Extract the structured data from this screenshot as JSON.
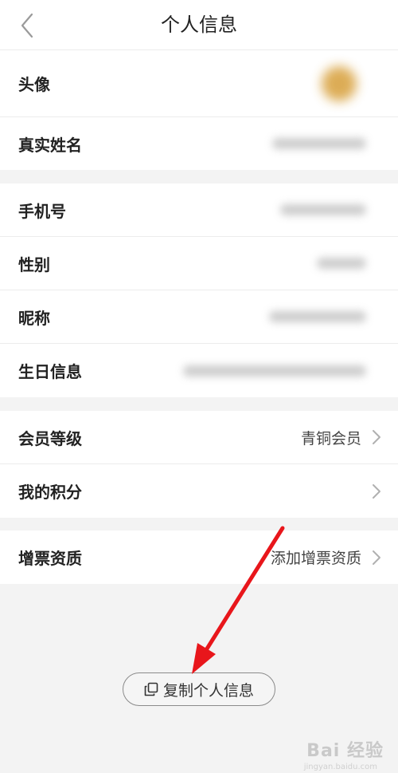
{
  "header": {
    "title": "个人信息"
  },
  "group1": {
    "rows": [
      {
        "label": "头像"
      },
      {
        "label": "真实姓名"
      }
    ]
  },
  "group2": {
    "rows": [
      {
        "label": "手机号"
      },
      {
        "label": "性别"
      },
      {
        "label": "昵称"
      },
      {
        "label": "生日信息"
      }
    ]
  },
  "group3": {
    "rows": [
      {
        "label": "会员等级",
        "value": "青铜会员"
      },
      {
        "label": "我的积分",
        "value": ""
      }
    ]
  },
  "group4": {
    "rows": [
      {
        "label": "增票资质",
        "value": "添加增票资质"
      }
    ]
  },
  "copy_button": {
    "label": "复制个人信息"
  },
  "watermark": {
    "text": "Bai 经验",
    "sub": "jingyan.baidu.com"
  },
  "colors": {
    "annotation_arrow": "#e8161b",
    "background": "#f3f3f3"
  }
}
